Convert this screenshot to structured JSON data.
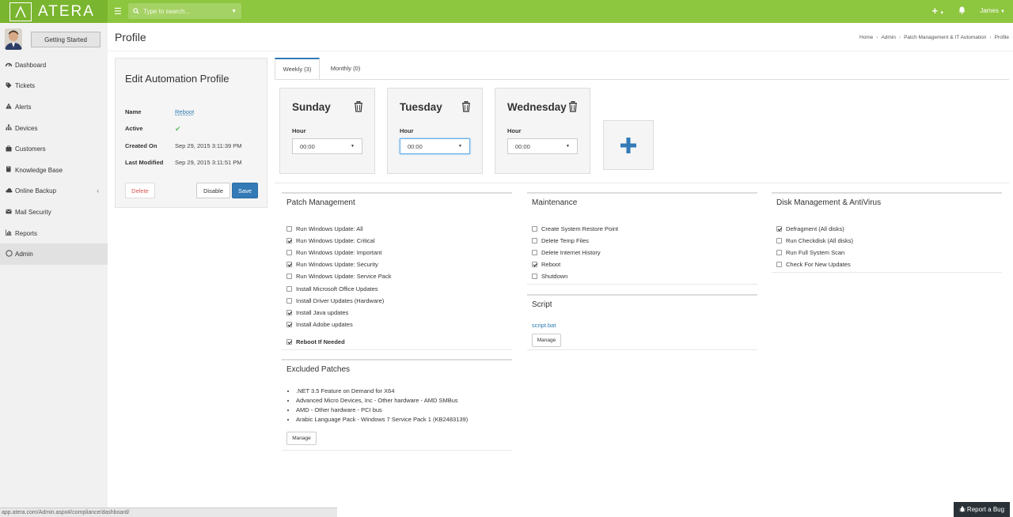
{
  "app": {
    "logo": "ATERA"
  },
  "topbar": {
    "search_placeholder": "Type to search...",
    "user": "James"
  },
  "sidebar": {
    "getting_started": "Getting Started",
    "items": [
      {
        "label": "Dashboard",
        "icon": "dashboard-icon"
      },
      {
        "label": "Tickets",
        "icon": "tag-icon"
      },
      {
        "label": "Alerts",
        "icon": "warning-icon"
      },
      {
        "label": "Devices",
        "icon": "sitemap-icon"
      },
      {
        "label": "Customers",
        "icon": "briefcase-icon"
      },
      {
        "label": "Knowledge Base",
        "icon": "book-icon"
      },
      {
        "label": "Online Backup",
        "icon": "cloud-icon"
      },
      {
        "label": "Mail Security",
        "icon": "envelope-icon"
      },
      {
        "label": "Reports",
        "icon": "bar-chart-icon"
      },
      {
        "label": "Admin",
        "icon": "circle-icon"
      }
    ]
  },
  "header": {
    "title": "Profile",
    "breadcrumb": [
      "Home",
      "Admin",
      "Patch Management & IT Automation",
      "Profile"
    ]
  },
  "edit_profile": {
    "title": "Edit Automation Profile",
    "name_label": "Name",
    "name_value": "Reboot",
    "active_label": "Active",
    "created_label": "Created On",
    "created_value": "Sep 29, 2015 3:11:39 PM",
    "modified_label": "Last Modified",
    "modified_value": "Sep 29, 2015 3:11:51 PM",
    "delete_label": "Delete",
    "disable_label": "Disable",
    "save_label": "Save"
  },
  "tabs": [
    {
      "label": "Weekly (3)"
    },
    {
      "label": "Monthly (0)"
    }
  ],
  "days": [
    {
      "name": "Sunday",
      "hour_label": "Hour",
      "hour_value": "00:00"
    },
    {
      "name": "Tuesday",
      "hour_label": "Hour",
      "hour_value": "00:00"
    },
    {
      "name": "Wednesday",
      "hour_label": "Hour",
      "hour_value": "00:00"
    }
  ],
  "patch_management": {
    "title": "Patch Management",
    "items": [
      {
        "label": "Run Windows Update: All",
        "checked": false
      },
      {
        "label": "Run Windows Update: Critical",
        "checked": true
      },
      {
        "label": "Run Windows Update: Important",
        "checked": false
      },
      {
        "label": "Run Windows Update: Security",
        "checked": true
      },
      {
        "label": "Run Windows Update: Service Pack",
        "checked": false
      },
      {
        "label": "Install Microsoft Office Updates",
        "checked": false
      },
      {
        "label": "Install Driver Updates (Hardware)",
        "checked": false
      },
      {
        "label": "Install Java updates",
        "checked": true
      },
      {
        "label": "Install Adobe updates",
        "checked": true
      }
    ],
    "reboot_if_needed": {
      "label": "Reboot If Needed",
      "checked": true
    }
  },
  "excluded_patches": {
    "title": "Excluded Patches",
    "items": [
      ".NET 3.5 Feature on Demand for X64",
      "Advanced Micro Devices, Inc - Other hardware - AMD SMBus",
      "AMD - Other hardware - PCI bus",
      "Arabic Language Pack - Windows 7 Service Pack 1 (KB2483139)"
    ],
    "manage_label": "Manage"
  },
  "maintenance": {
    "title": "Maintenance",
    "items": [
      {
        "label": "Create System Restore Point",
        "checked": false
      },
      {
        "label": "Delete Temp Files",
        "checked": false
      },
      {
        "label": "Delete Internet History",
        "checked": false
      },
      {
        "label": "Reboot",
        "checked": true
      },
      {
        "label": "Shutdown",
        "checked": false
      }
    ]
  },
  "script": {
    "title": "Script",
    "file": "script.bat",
    "manage_label": "Manage"
  },
  "disk_management": {
    "title": "Disk Management & AntiVirus",
    "items": [
      {
        "label": "Defragment (All disks)",
        "checked": true
      },
      {
        "label": "Run Checkdisk (All disks)",
        "checked": false
      },
      {
        "label": "Run Full System Scan",
        "checked": false
      },
      {
        "label": "Check For New Updates",
        "checked": false
      }
    ]
  },
  "statusbar": {
    "url": "app.atera.com/Admin.aspx#/compliance/dashboard/"
  },
  "report_bug": {
    "label": "Report a Bug"
  },
  "colors": {
    "brand_green": "#8dc63f",
    "primary_blue": "#337ab7",
    "danger_red": "#d9534f",
    "success_green": "#5cb85c"
  }
}
